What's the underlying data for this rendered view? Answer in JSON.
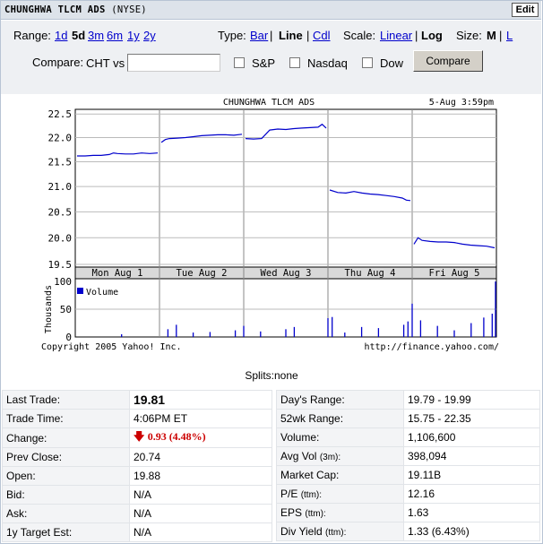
{
  "header": {
    "title": "CHUNGHWA TLCM ADS",
    "exchange": "(NYSE)",
    "edit_label": "Edit"
  },
  "controls": {
    "range_label": "Range:",
    "ranges": [
      "1d",
      "5d",
      "3m",
      "6m",
      "1y",
      "2y"
    ],
    "range_selected": "5d",
    "type_label": "Type:",
    "types": [
      "Bar",
      "Line",
      "Cdl"
    ],
    "type_selected": "Line",
    "scale_label": "Scale:",
    "scales": [
      "Linear",
      "Log"
    ],
    "scale_selected": "Log",
    "size_label": "Size:",
    "sizes": [
      "M",
      "L"
    ],
    "size_selected": "M",
    "compare_label": "Compare:",
    "compare_prefix": "CHT vs",
    "compare_value": "",
    "checkboxes": [
      "S&P",
      "Nasdaq",
      "Dow"
    ],
    "compare_button": "Compare"
  },
  "chart_data": {
    "type": "line",
    "title": "CHUNGHWA TLCM ADS",
    "timestamp": "5-Aug 3:59pm",
    "days": [
      "Mon Aug  1",
      "Tue Aug  2",
      "Wed Aug  3",
      "Thu Aug  4",
      "Fri Aug  5"
    ],
    "price_axis": {
      "ticks": [
        "22.5",
        "22.0",
        "21.5",
        "21.0",
        "20.5",
        "20.0",
        "19.5"
      ],
      "ylim": [
        19.45,
        22.6
      ],
      "scale": "log"
    },
    "price_series": [
      {
        "day": 0,
        "points": [
          [
            0.0,
            21.62
          ],
          [
            0.1,
            21.62
          ],
          [
            0.2,
            21.63
          ],
          [
            0.3,
            21.63
          ],
          [
            0.4,
            21.65
          ],
          [
            0.45,
            21.68
          ],
          [
            0.5,
            21.67
          ],
          [
            0.6,
            21.66
          ],
          [
            0.7,
            21.66
          ],
          [
            0.8,
            21.68
          ],
          [
            0.9,
            21.67
          ],
          [
            1.0,
            21.68
          ]
        ]
      },
      {
        "day": 1,
        "points": [
          [
            0.0,
            21.9
          ],
          [
            0.05,
            21.96
          ],
          [
            0.1,
            21.98
          ],
          [
            0.2,
            21.99
          ],
          [
            0.3,
            22.0
          ],
          [
            0.4,
            22.02
          ],
          [
            0.5,
            22.04
          ],
          [
            0.6,
            22.05
          ],
          [
            0.7,
            22.06
          ],
          [
            0.8,
            22.06
          ],
          [
            0.9,
            22.05
          ],
          [
            1.0,
            22.07
          ]
        ]
      },
      {
        "day": 2,
        "points": [
          [
            0.0,
            21.98
          ],
          [
            0.1,
            21.97
          ],
          [
            0.2,
            21.98
          ],
          [
            0.3,
            22.16
          ],
          [
            0.4,
            22.18
          ],
          [
            0.5,
            22.17
          ],
          [
            0.6,
            22.19
          ],
          [
            0.7,
            22.2
          ],
          [
            0.8,
            22.21
          ],
          [
            0.9,
            22.22
          ],
          [
            0.95,
            22.28
          ],
          [
            1.0,
            22.2
          ]
        ]
      },
      {
        "day": 3,
        "points": [
          [
            0.0,
            20.93
          ],
          [
            0.1,
            20.88
          ],
          [
            0.2,
            20.87
          ],
          [
            0.3,
            20.9
          ],
          [
            0.4,
            20.87
          ],
          [
            0.5,
            20.85
          ],
          [
            0.6,
            20.84
          ],
          [
            0.7,
            20.82
          ],
          [
            0.8,
            20.8
          ],
          [
            0.9,
            20.77
          ],
          [
            0.95,
            20.73
          ],
          [
            1.0,
            20.72
          ]
        ]
      },
      {
        "day": 4,
        "points": [
          [
            0.0,
            19.88
          ],
          [
            0.05,
            20.0
          ],
          [
            0.1,
            19.95
          ],
          [
            0.2,
            19.93
          ],
          [
            0.3,
            19.92
          ],
          [
            0.4,
            19.92
          ],
          [
            0.5,
            19.91
          ],
          [
            0.6,
            19.88
          ],
          [
            0.7,
            19.86
          ],
          [
            0.8,
            19.85
          ],
          [
            0.9,
            19.84
          ],
          [
            1.0,
            19.81
          ]
        ]
      }
    ],
    "volume_axis": {
      "label": "Thousands",
      "ticks": [
        "100",
        "50",
        "0"
      ],
      "ylim": [
        0,
        105
      ]
    },
    "volume_legend": "Volume",
    "volume_spikes": [
      [
        0.55,
        5
      ],
      [
        1.1,
        14
      ],
      [
        1.2,
        22
      ],
      [
        1.4,
        8
      ],
      [
        1.6,
        9
      ],
      [
        1.9,
        12
      ],
      [
        2.0,
        20
      ],
      [
        2.2,
        10
      ],
      [
        2.5,
        14
      ],
      [
        2.6,
        18
      ],
      [
        3.0,
        34
      ],
      [
        3.05,
        36
      ],
      [
        3.2,
        8
      ],
      [
        3.4,
        18
      ],
      [
        3.6,
        16
      ],
      [
        3.9,
        22
      ],
      [
        3.95,
        28
      ],
      [
        4.0,
        60
      ],
      [
        4.1,
        30
      ],
      [
        4.3,
        20
      ],
      [
        4.5,
        12
      ],
      [
        4.7,
        25
      ],
      [
        4.85,
        35
      ],
      [
        4.95,
        42
      ],
      [
        5.0,
        100
      ]
    ],
    "series_color": "#0000cc",
    "copyright": "Copyright 2005 Yahoo! Inc.",
    "source_url": "http://finance.yahoo.com/"
  },
  "splits": "Splits:none",
  "quote_left": [
    {
      "label": "Last Trade:",
      "value": "19.81"
    },
    {
      "label": "Trade Time:",
      "value": "4:06PM ET"
    },
    {
      "label": "Change:",
      "value": "0.93 (4.48%)"
    },
    {
      "label": "Prev Close:",
      "value": "20.74"
    },
    {
      "label": "Open:",
      "value": "19.88"
    },
    {
      "label": "Bid:",
      "value": "N/A"
    },
    {
      "label": "Ask:",
      "value": "N/A"
    },
    {
      "label": "1y Target Est:",
      "value": "N/A"
    }
  ],
  "quote_right": [
    {
      "label": "Day's Range:",
      "suffix": "",
      "value": "19.79 - 19.99"
    },
    {
      "label": "52wk Range:",
      "suffix": "",
      "value": "15.75 - 22.35"
    },
    {
      "label": "Volume:",
      "suffix": "",
      "value": "1,106,600"
    },
    {
      "label": "Avg Vol",
      "suffix": "(3m):",
      "value": "398,094"
    },
    {
      "label": "Market Cap:",
      "suffix": "",
      "value": "19.11B"
    },
    {
      "label": "P/E",
      "suffix": "(ttm):",
      "value": "12.16"
    },
    {
      "label": "EPS",
      "suffix": "(ttm):",
      "value": "1.63"
    },
    {
      "label": "Div Yield",
      "suffix": "(ttm):",
      "value": "1.33 (6.43%)"
    }
  ]
}
